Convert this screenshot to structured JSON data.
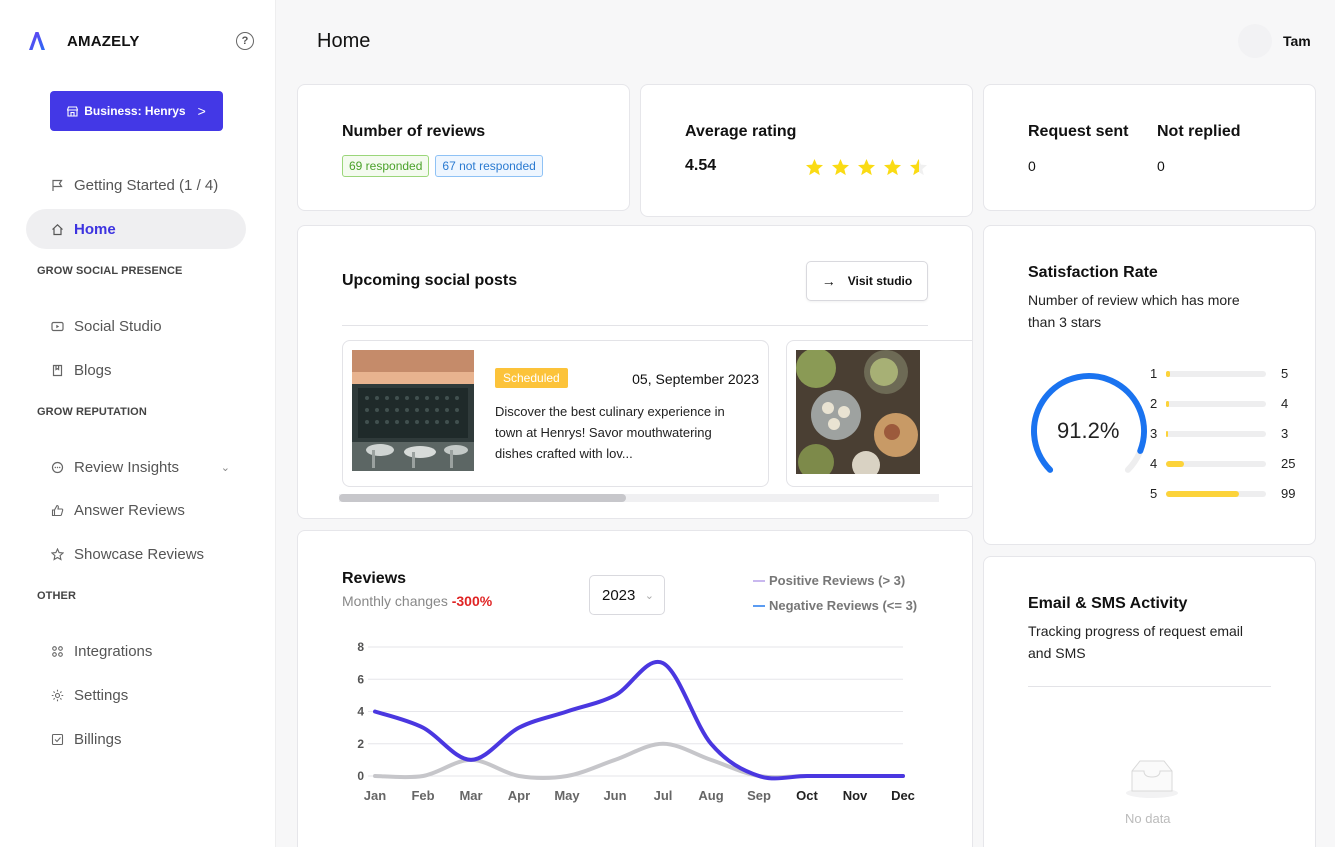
{
  "app": {
    "brand": "AMAZELY",
    "help_icon": "?"
  },
  "business_button": {
    "label": "Business: Henrys",
    "chevron": ">"
  },
  "sidebar": {
    "getting_started": "Getting Started (1 / 4)",
    "home": "Home",
    "sections": {
      "grow_social": "GROW SOCIAL PRESENCE",
      "grow_reputation": "GROW REPUTATION",
      "other": "OTHER"
    },
    "items": {
      "social_studio": "Social Studio",
      "blogs": "Blogs",
      "review_insights": "Review Insights",
      "answer_reviews": "Answer Reviews",
      "showcase_reviews": "Showcase Reviews",
      "integrations": "Integrations",
      "settings": "Settings",
      "billings": "Billings"
    }
  },
  "header": {
    "title": "Home",
    "user_name": "Tam"
  },
  "reviews_count": {
    "title": "Number of reviews",
    "responded": "69 responded",
    "not_responded": "67 not responded"
  },
  "average_rating": {
    "title": "Average rating",
    "value": "4.54",
    "stars": 4.54
  },
  "requests": {
    "sent_label": "Request sent",
    "sent_value": "0",
    "not_replied_label": "Not replied",
    "not_replied_value": "0"
  },
  "social_posts": {
    "title": "Upcoming social posts",
    "visit_button": "Visit studio",
    "post": {
      "status": "Scheduled",
      "date": "05, September 2023",
      "text_line1": "Discover the best culinary experience in",
      "text_line2": "town at Henrys! Savor mouthwatering",
      "text_line3": "dishes crafted with lov..."
    },
    "scroll_position": 0.48
  },
  "satisfaction": {
    "title": "Satisfaction Rate",
    "subtitle_line1": "Number of review which has more",
    "subtitle_line2": "than 3 stars",
    "percent_label": "91.2%",
    "percent": 91.2,
    "distribution": [
      {
        "star": "1",
        "count": "5",
        "value": 5
      },
      {
        "star": "2",
        "count": "4",
        "value": 4
      },
      {
        "star": "3",
        "count": "3",
        "value": 3
      },
      {
        "star": "4",
        "count": "25",
        "value": 25
      },
      {
        "star": "5",
        "count": "99",
        "value": 99
      }
    ],
    "colors": {
      "arc": "#1a73f0",
      "bar": "#fcd33a",
      "track": "#eeeeef"
    }
  },
  "reviews_chart": {
    "title": "Reviews",
    "monthly_label": "Monthly changes",
    "monthly_value": "-300%",
    "year": "2023",
    "legend_positive": "Positive Reviews (> 3)",
    "legend_negative": "Negative Reviews (<= 3)",
    "colors": {
      "positive": "#c6c6ca",
      "negative": "#4a37e0",
      "change": "#e02424"
    }
  },
  "chart_data": {
    "type": "line",
    "categories": [
      "Jan",
      "Feb",
      "Mar",
      "Apr",
      "May",
      "Jun",
      "Jul",
      "Aug",
      "Sep",
      "Oct",
      "Nov",
      "Dec"
    ],
    "series": [
      {
        "name": "Positive Reviews (> 3)",
        "values": [
          0,
          0,
          1,
          0,
          0,
          1,
          2,
          1,
          0,
          0,
          0,
          0
        ]
      },
      {
        "name": "Negative Reviews (<= 3)",
        "values": [
          4,
          3,
          1,
          3,
          4,
          5,
          7,
          2,
          0,
          0,
          0,
          0
        ]
      }
    ],
    "yticks": [
      "0",
      "2",
      "4",
      "6",
      "8"
    ],
    "ylim": [
      0,
      8
    ],
    "grid": true
  },
  "email_sms": {
    "title": "Email & SMS Activity",
    "subtitle_line1": "Tracking progress of request email",
    "subtitle_line2": "and SMS",
    "empty": "No data"
  }
}
